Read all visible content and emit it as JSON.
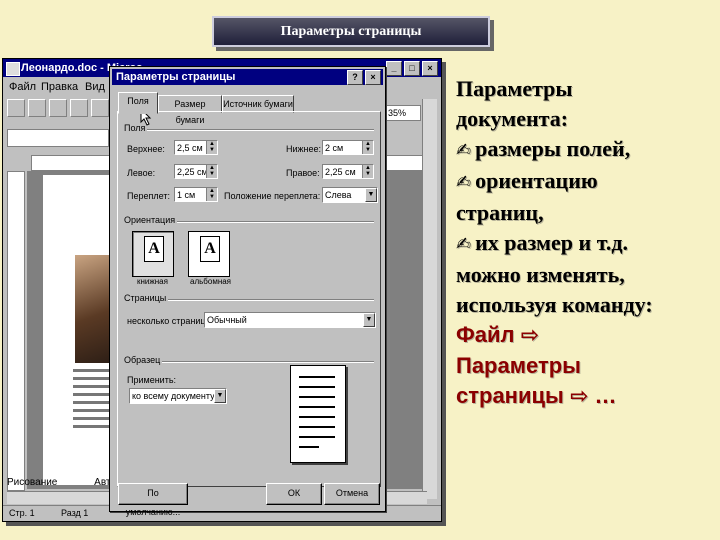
{
  "slide_title": "Параметры страницы",
  "word": {
    "title": "Леонардо.doc - Micros",
    "win_buttons": [
      "_",
      "□",
      "×"
    ],
    "menu": [
      "Файл",
      "Правка",
      "Вид"
    ],
    "zoom": "35%",
    "draw_menu": "Рисование",
    "draw_tool": "Автоф",
    "status": {
      "page": "Стр. 1",
      "section": "Разд 1"
    }
  },
  "dialog": {
    "title": "Параметры страницы",
    "title_buttons": [
      "?",
      "×"
    ],
    "tabs": [
      "Поля",
      "Размер бумаги",
      "Источник бумаги"
    ],
    "fields_group": "Поля",
    "top_label": "Верхнее:",
    "top_value": "2,5 см",
    "bottom_label": "Нижнее:",
    "bottom_value": "2 см",
    "left_label": "Левое:",
    "left_value": "2,25 см",
    "right_label": "Правое:",
    "right_value": "2,25 см",
    "gutter_label": "Переплет:",
    "gutter_value": "1 см",
    "gutter_pos_label": "Положение переплета:",
    "gutter_pos_value": "Слева",
    "orientation_group": "Ориентация",
    "portrait_label": "книжная",
    "landscape_label": "альбомная",
    "pages_group": "Страницы",
    "multiple_pages_label": "несколько страниц:",
    "multiple_pages_value": "Обычный",
    "sample_group": "Образец",
    "apply_label": "Применить:",
    "apply_value": "ко всему документу",
    "default_button": "По умолчанию...",
    "ok_button": "ОК",
    "cancel_button": "Отмена",
    "glyph": "A"
  },
  "text": {
    "line1": "Параметры",
    "line2": "документа:",
    "line3": "размеры полей,",
    "line4": "ориентацию",
    "line5": "страниц,",
    "line6": "их размер  и т.д.",
    "line7": "можно изменять,",
    "line8": "используя команду:",
    "cmd1": "Файл",
    "cmd2": "Параметры",
    "cmd3": "страницы",
    "cmd_end": "…",
    "bullet": "✍",
    "arrow": "⇨"
  },
  "colors": {
    "background": "#f7f2c6",
    "titlebar": "#000080",
    "command": "#8b0000"
  }
}
